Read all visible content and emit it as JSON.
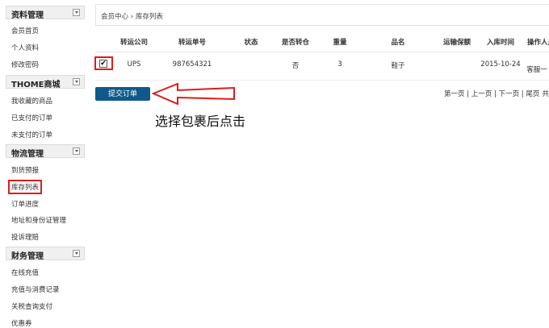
{
  "sidebar": {
    "sections": [
      {
        "title": "资料管理",
        "items": [
          "会员首页",
          "个人资料",
          "修改密码"
        ]
      },
      {
        "title": "THOME商城",
        "items": [
          "我收藏的商品",
          "已支付的订单",
          "未支付的订单"
        ]
      },
      {
        "title": "物流管理",
        "items": [
          "到货预报",
          "库存列表",
          "订单进度",
          "地址和身份证管理",
          "投诉理赔"
        ]
      },
      {
        "title": "财务管理",
        "items": [
          "在线充值",
          "充值与消费记录",
          "关税查询支付",
          "优惠券"
        ]
      }
    ],
    "active_item": "库存列表"
  },
  "breadcrumb": {
    "home": "会员中心",
    "separator": "›",
    "current": "库存列表"
  },
  "table": {
    "headers": [
      "转运公司",
      "转运单号",
      "状态",
      "是否转仓",
      "重量",
      "品名",
      "运输保额",
      "入库时间",
      "操作人员"
    ],
    "rows": [
      {
        "checked": true,
        "company": "UPS",
        "tracking_no": "987654321",
        "status": "",
        "transfer": "否",
        "weight": "3",
        "product": "鞋子",
        "insured": "",
        "date": "2015-10-24",
        "operator": "客服一"
      }
    ]
  },
  "actions": {
    "submit_label": "提交订单"
  },
  "pagination": {
    "first": "第一页",
    "prev": "上一页",
    "next": "下一页",
    "last": "尾页",
    "total": "共有"
  },
  "annotation": {
    "text": "选择包裹后点击"
  },
  "colors": {
    "highlight": "#e01b1b",
    "button": "#0f5a8a"
  }
}
